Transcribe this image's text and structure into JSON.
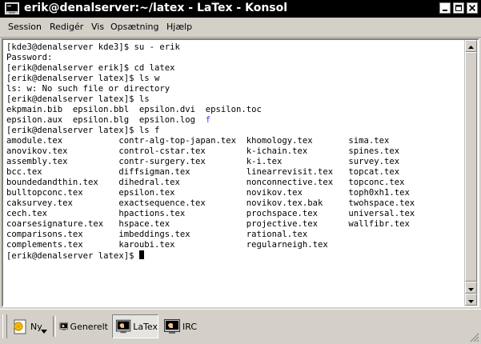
{
  "window": {
    "title": "erik@denalserver:~/latex - LaTex - Konsol"
  },
  "menu": [
    "Session",
    "Redigér",
    "Vis",
    "Opsætning",
    "Hjælp"
  ],
  "terminal": {
    "lines": [
      "[kde3@denalserver kde3]$ su - erik",
      "Password:",
      "[erik@denalserver erik]$ cd latex",
      "[erik@denalserver latex]$ ls w",
      "ls: w: No such file or directory",
      "[erik@denalserver latex]$ ls",
      "ekpmain.bib  epsilon.bbl  epsilon.dvi  epsilon.toc",
      "epsilon.aux  epsilon.blg  epsilon.log  f",
      "[erik@denalserver latex]$ ls f",
      "amodule.tex           contr-alg-top-japan.tex  khomology.tex       sima.tex",
      "anovikov.tex          control-cstar.tex        k-ichain.tex        spines.tex",
      "assembly.tex          contr-surgery.tex        k-i.tex             survey.tex",
      "bcc.tex               diffsigman.tex           linearrevisit.tex   topcat.tex",
      "boundedandthin.tex    dihedral.tex             nonconnective.tex   topconc.tex",
      "bulltopconc.tex       epsilon.tex              novikov.tex         toph0xh1.tex",
      "caksurvey.tex         exactsequence.tex        novikov.tex.bak     twohspace.tex",
      "cech.tex              hpactions.tex            prochspace.tex      universal.tex",
      "coarsesignature.tex   hspace.tex               projective.tex      wallfibr.tex",
      "comparisons.tex       imbeddings.tex           rational.tex",
      "complements.tex       karoubi.tex              regularneigh.tex",
      "[erik@denalserver latex]$ "
    ],
    "dir_entry_color": "#4040ff"
  },
  "taskbar": {
    "new_label": "Ny",
    "tabs": [
      "Generelt",
      "LaTex",
      "IRC"
    ],
    "active_tab": "LaTex"
  }
}
